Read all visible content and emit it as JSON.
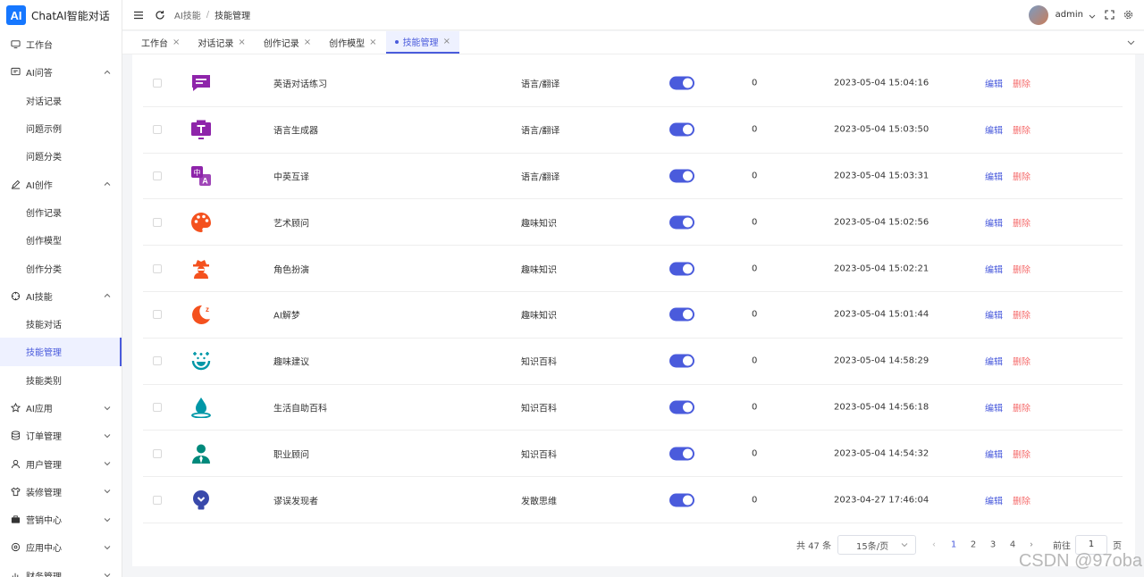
{
  "app": {
    "logo_mark": "AI",
    "title": "ChatAI智能对话"
  },
  "sidebar": {
    "items": [
      {
        "label": "工作台",
        "icon": "monitor-icon"
      },
      {
        "label": "AI问答",
        "icon": "chat-icon",
        "expanded": true,
        "children": [
          "对话记录",
          "问题示例",
          "问题分类"
        ]
      },
      {
        "label": "AI创作",
        "icon": "pen-icon",
        "expanded": true,
        "children": [
          "创作记录",
          "创作模型",
          "创作分类"
        ]
      },
      {
        "label": "AI技能",
        "icon": "crosshair-icon",
        "expanded": true,
        "children": [
          "技能对话",
          "技能管理",
          "技能类别"
        ]
      },
      {
        "label": "AI应用",
        "icon": "star-icon"
      },
      {
        "label": "订单管理",
        "icon": "database-icon"
      },
      {
        "label": "用户管理",
        "icon": "user-icon"
      },
      {
        "label": "装修管理",
        "icon": "shirt-icon"
      },
      {
        "label": "营销中心",
        "icon": "briefcase-icon"
      },
      {
        "label": "应用中心",
        "icon": "gear-circle-icon"
      },
      {
        "label": "财务管理",
        "icon": "chart-icon"
      }
    ],
    "active": "技能管理"
  },
  "header": {
    "breadcrumb": [
      "AI技能",
      "技能管理"
    ],
    "user": "admin"
  },
  "tabs": [
    {
      "label": "工作台"
    },
    {
      "label": "对话记录"
    },
    {
      "label": "创作记录"
    },
    {
      "label": "创作模型"
    },
    {
      "label": "技能管理",
      "active": true
    }
  ],
  "table": {
    "rows": [
      {
        "name": "英语对话练习",
        "category": "语言/翻译",
        "enabled": true,
        "count": "0",
        "time": "2023-05-04 15:04:16",
        "icon": "chat-bubble-icon",
        "color": "#8e24aa"
      },
      {
        "name": "语言生成器",
        "category": "语言/翻译",
        "enabled": true,
        "count": "0",
        "time": "2023-05-04 15:03:50",
        "icon": "text-board-icon",
        "color": "#8e24aa"
      },
      {
        "name": "中英互译",
        "category": "语言/翻译",
        "enabled": true,
        "count": "0",
        "time": "2023-05-04 15:03:31",
        "icon": "translate-icon",
        "color": "#8e24aa"
      },
      {
        "name": "艺术顾问",
        "category": "趣味知识",
        "enabled": true,
        "count": "0",
        "time": "2023-05-04 15:02:56",
        "icon": "palette-icon",
        "color": "#f4511e"
      },
      {
        "name": "角色扮演",
        "category": "趣味知识",
        "enabled": true,
        "count": "0",
        "time": "2023-05-04 15:02:21",
        "icon": "detective-icon",
        "color": "#f4511e"
      },
      {
        "name": "AI解梦",
        "category": "趣味知识",
        "enabled": true,
        "count": "0",
        "time": "2023-05-04 15:01:44",
        "icon": "moon-sleep-icon",
        "color": "#f4511e"
      },
      {
        "name": "趣味建议",
        "category": "知识百科",
        "enabled": true,
        "count": "0",
        "time": "2023-05-04 14:58:29",
        "icon": "smile-sparkle-icon",
        "color": "#0097a7"
      },
      {
        "name": "生活自助百科",
        "category": "知识百科",
        "enabled": true,
        "count": "0",
        "time": "2023-05-04 14:56:18",
        "icon": "water-drop-icon",
        "color": "#0097a7"
      },
      {
        "name": "职业顾问",
        "category": "知识百科",
        "enabled": true,
        "count": "0",
        "time": "2023-05-04 14:54:32",
        "icon": "businessman-icon",
        "color": "#00897b"
      },
      {
        "name": "谬误发现者",
        "category": "发散思维",
        "enabled": true,
        "count": "0",
        "time": "2023-04-27 17:46:04",
        "icon": "lightbulb-icon",
        "color": "#3949ab"
      }
    ],
    "edit_label": "编辑",
    "delete_label": "删除"
  },
  "pagination": {
    "total_text": "共 47 条",
    "page_size": "15条/页",
    "pages": [
      "1",
      "2",
      "3",
      "4"
    ],
    "current": "1",
    "goto_label": "前往",
    "goto_value": "1",
    "unit": "页"
  },
  "watermark": "CSDN @97oba",
  "colors": {
    "accent": "#4a5bdc",
    "danger": "#f56c6c"
  }
}
